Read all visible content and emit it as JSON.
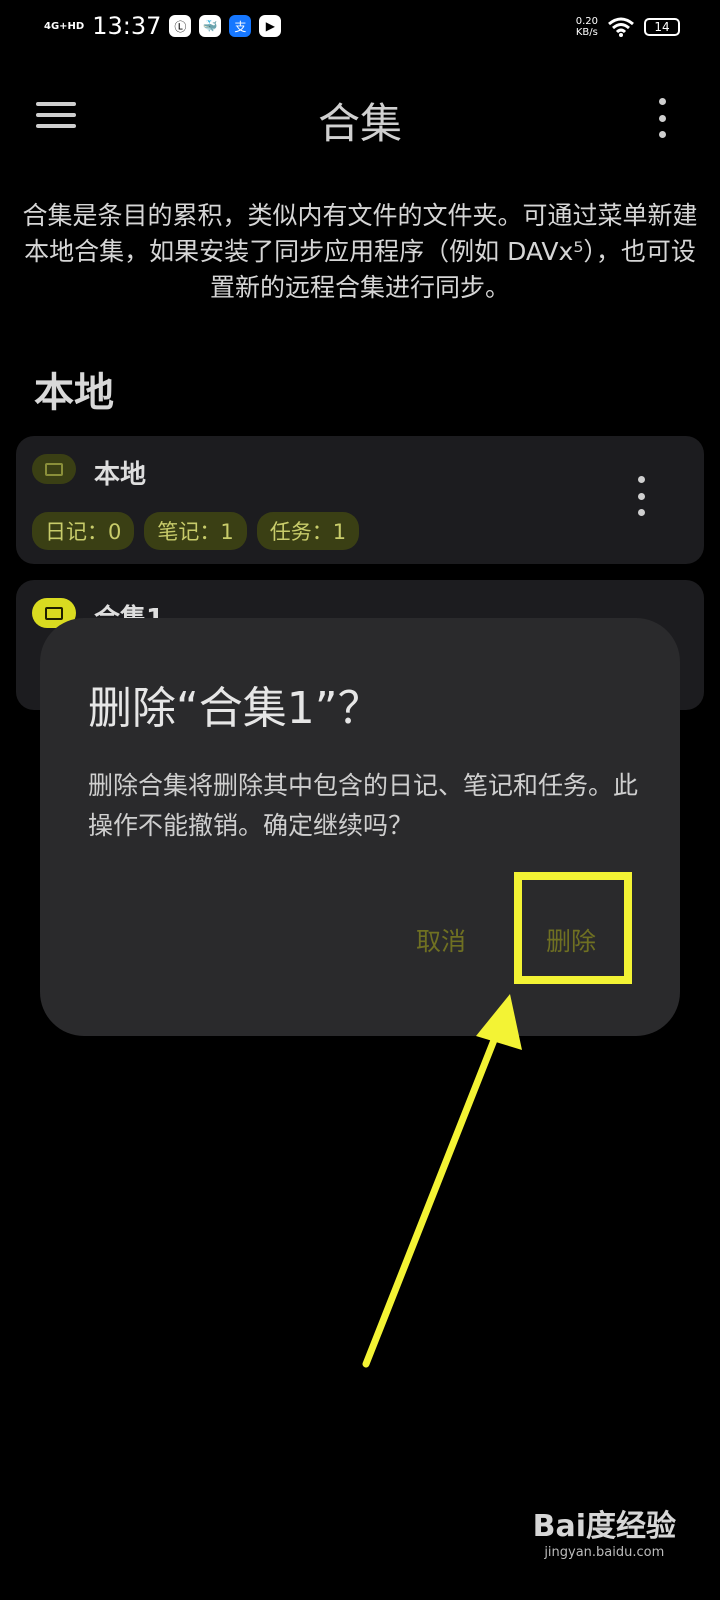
{
  "status_bar": {
    "network": "4G+HD",
    "time": "13:37",
    "app_icons": [
      "Ⓛ",
      "🐳",
      "支",
      "▶"
    ],
    "speed": "0.20",
    "speed_unit": "KB/s",
    "battery": "14"
  },
  "app_bar": {
    "title": "合集"
  },
  "intro": "合集是条目的累积，类似内有文件的文件夹。可通过菜单新建本地合集，如果安装了同步应用程序（例如 DAVx⁵），也可设置新的远程合集进行同步。",
  "section_title": "本地",
  "collections": [
    {
      "name": "本地",
      "counts": [
        "日记：0",
        "笔记：1",
        "任务：1"
      ]
    },
    {
      "name": "合集1"
    }
  ],
  "dialog": {
    "title": "删除“合集1”？",
    "message": "删除合集将删除其中包含的日记、笔记和任务。此操作不能撤销。确定继续吗？",
    "cancel_label": "取消",
    "delete_label": "删除"
  },
  "colors": {
    "accent_yellow": "#f3f334",
    "dialog_bg": "#2a2a2c",
    "button_text": "#6f7022"
  },
  "watermark": {
    "brand": "Bai度经验",
    "url": "jingyan.baidu.com"
  }
}
